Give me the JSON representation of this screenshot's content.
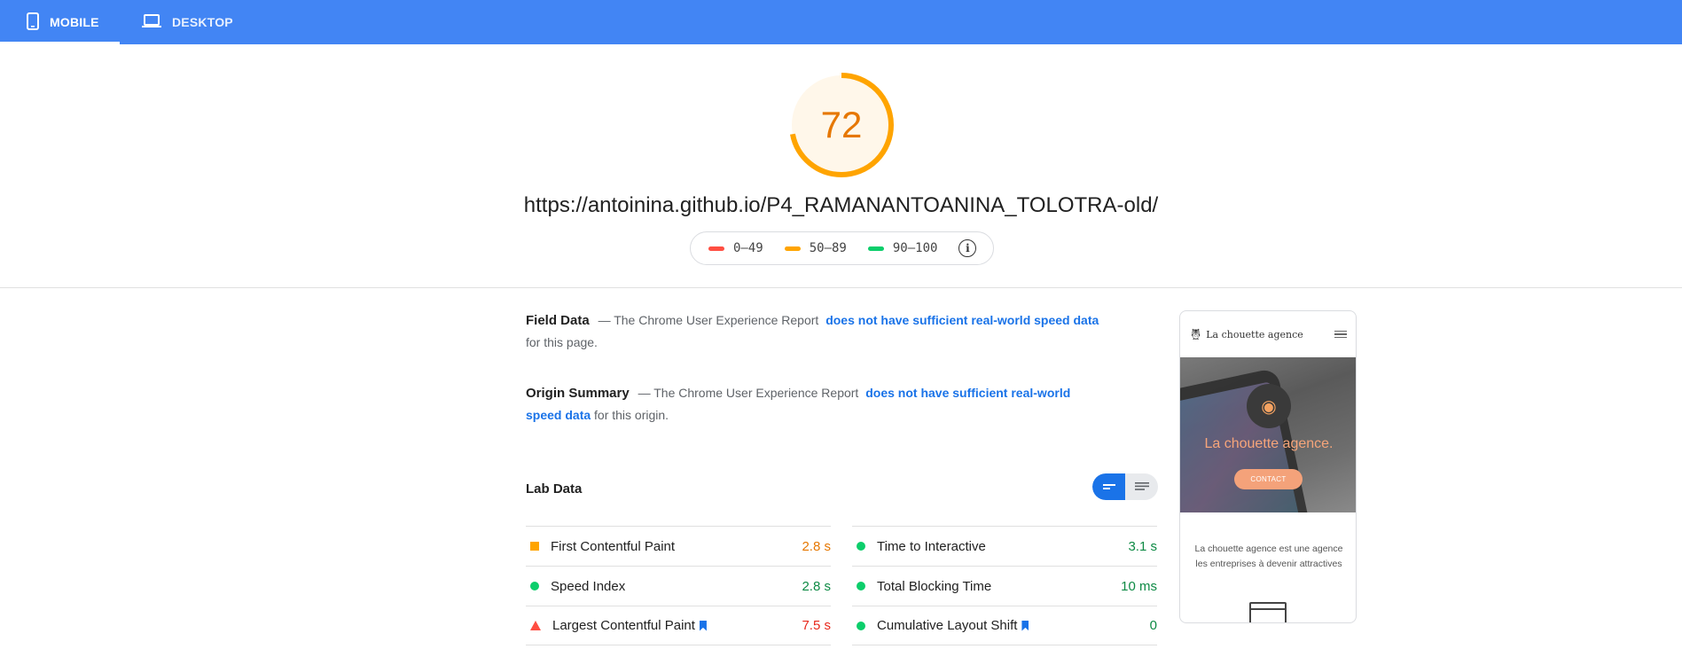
{
  "tabs": [
    {
      "label": "MOBILE",
      "icon": "smartphone-icon",
      "active": true
    },
    {
      "label": "DESKTOP",
      "icon": "laptop-icon",
      "active": false
    }
  ],
  "score": {
    "value": "72",
    "fraction": 0.72,
    "color": "#ffa400",
    "bg": "#fff7ea"
  },
  "url": "https://antoinina.github.io/P4_RAMANANTOANINA_TOLOTRA-old/",
  "legend": [
    {
      "label": "0–49",
      "color": "#ff4e42"
    },
    {
      "label": "50–89",
      "color": "#ffa400"
    },
    {
      "label": "90–100",
      "color": "#0cce6b"
    }
  ],
  "field_data": {
    "heading": "Field Data",
    "prefix": "— The Chrome User Experience Report",
    "link": "does not have sufficient real-world speed data",
    "suffix": "for this page."
  },
  "origin_summary": {
    "heading": "Origin Summary",
    "prefix": "— The Chrome User Experience Report",
    "link": "does not have sufficient real-world speed data",
    "suffix": "for this origin."
  },
  "lab_data": {
    "title": "Lab Data",
    "left": [
      {
        "label": "First Contentful Paint",
        "value": "2.8 s",
        "status": "average",
        "bookmark": false
      },
      {
        "label": "Speed Index",
        "value": "2.8 s",
        "status": "pass",
        "bookmark": false
      },
      {
        "label": "Largest Contentful Paint",
        "value": "7.5 s",
        "status": "fail",
        "bookmark": true
      }
    ],
    "right": [
      {
        "label": "Time to Interactive",
        "value": "3.1 s",
        "status": "pass",
        "bookmark": false
      },
      {
        "label": "Total Blocking Time",
        "value": "10 ms",
        "status": "pass",
        "bookmark": false
      },
      {
        "label": "Cumulative Layout Shift",
        "value": "0",
        "status": "pass",
        "bookmark": true
      }
    ]
  },
  "status_colors": {
    "pass": "#0d8a44",
    "average": "#e67700",
    "fail": "#e8271b"
  },
  "preview": {
    "brand": "La chouette agence",
    "hero_title": "La chouette agence.",
    "button": "CONTACT",
    "text_line1": "La chouette agence est une agence",
    "text_line2": "les entreprises à devenir attractives"
  }
}
